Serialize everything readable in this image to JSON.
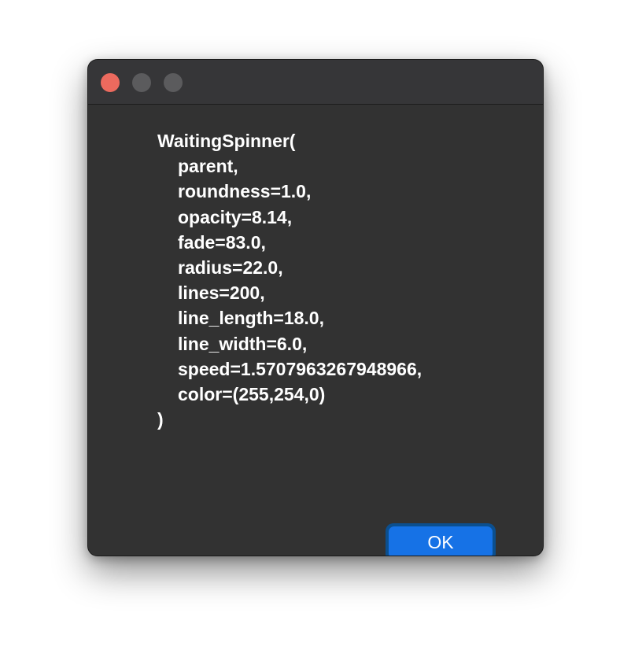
{
  "window": {
    "accent_color": "#1672e6",
    "background_color": "#323232",
    "close_button_color": "#ec6a5e"
  },
  "titlebar": {
    "buttons": [
      "close-icon",
      "minimize-icon",
      "zoom-icon"
    ]
  },
  "message": {
    "lines": [
      "WaitingSpinner(",
      "parent,",
      "roundness=1.0,",
      "opacity=8.14,",
      "fade=83.0,",
      "radius=22.0,",
      "lines=200,",
      "line_length=18.0,",
      "line_width=6.0,",
      "speed=1.5707963267948966,",
      "color=(255,254,0)",
      ")"
    ]
  },
  "ok_button": {
    "label": "OK"
  }
}
